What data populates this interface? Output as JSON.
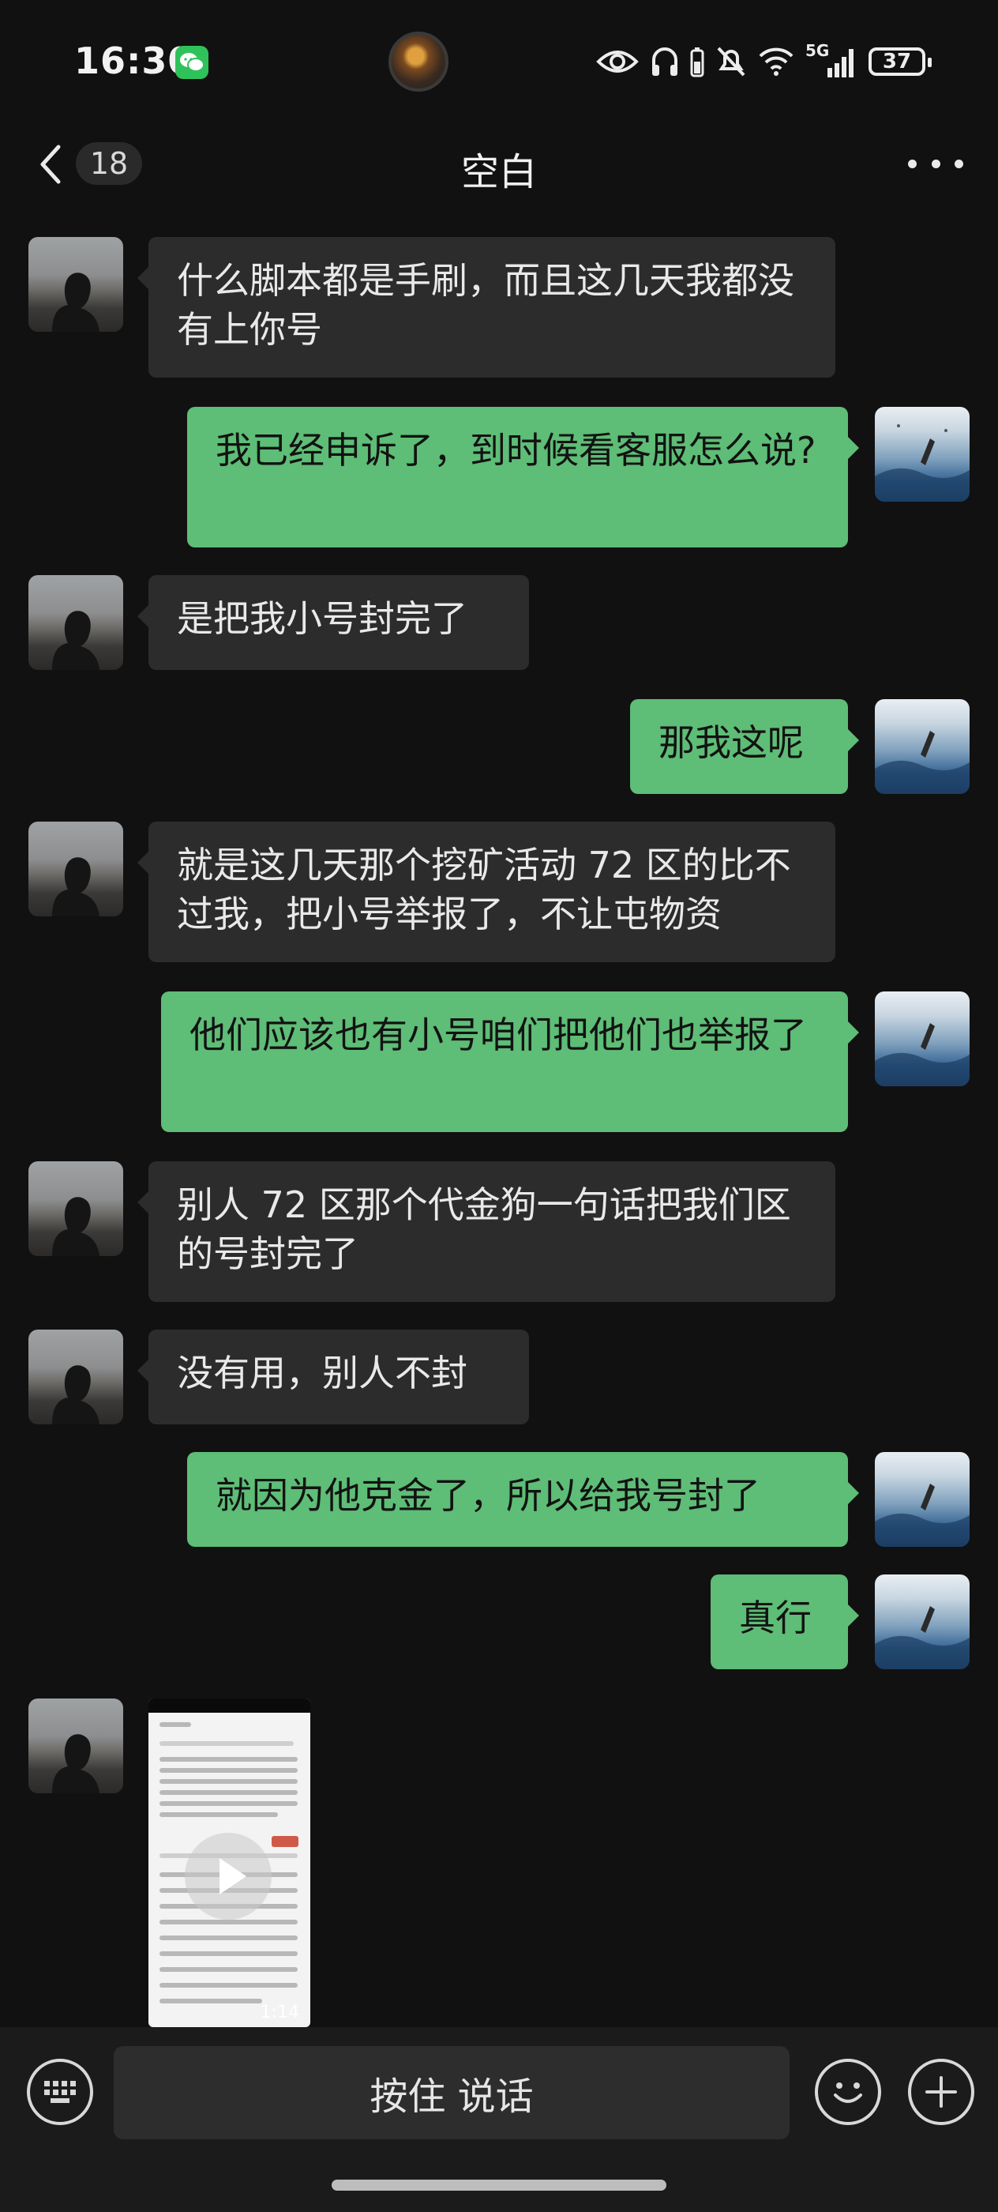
{
  "status_bar": {
    "time": "16:30",
    "network": "5G",
    "battery": "37",
    "icons": [
      "wechat-icon",
      "eye-icon",
      "headphones-icon",
      "battery-small-icon",
      "mute-bell-icon",
      "wifi-icon",
      "signal-icon"
    ]
  },
  "nav": {
    "unread_count": "18",
    "title": "空白"
  },
  "messages": [
    {
      "sender": "other",
      "text": "什么脚本都是手刷，而且这几天我都没有上你号"
    },
    {
      "sender": "me",
      "text": "我已经申诉了，到时候看客服怎么说?"
    },
    {
      "sender": "other",
      "text": "是把我小号封完了"
    },
    {
      "sender": "me",
      "text": "那我这呢"
    },
    {
      "sender": "other",
      "text": "就是这几天那个挖矿活动 72 区的比不过我，把小号举报了，不让屯物资"
    },
    {
      "sender": "me",
      "text": "他们应该也有小号咱们把他们也举报了"
    },
    {
      "sender": "other",
      "text": "别人 72 区那个代金狗一句话把我们区的号封完了"
    },
    {
      "sender": "other",
      "text": "没有用，别人不封"
    },
    {
      "sender": "me",
      "text": "就因为他克金了，所以给我号封了"
    },
    {
      "sender": "me",
      "text": "真行"
    },
    {
      "sender": "other",
      "type": "video",
      "duration": "1:14"
    }
  ],
  "input": {
    "voice_label": "按住 说话"
  },
  "colors": {
    "background": "#111111",
    "bubble_me": "#5ebd76",
    "bubble_other": "#2c2c2c",
    "input_bar": "#1b1b1b"
  }
}
